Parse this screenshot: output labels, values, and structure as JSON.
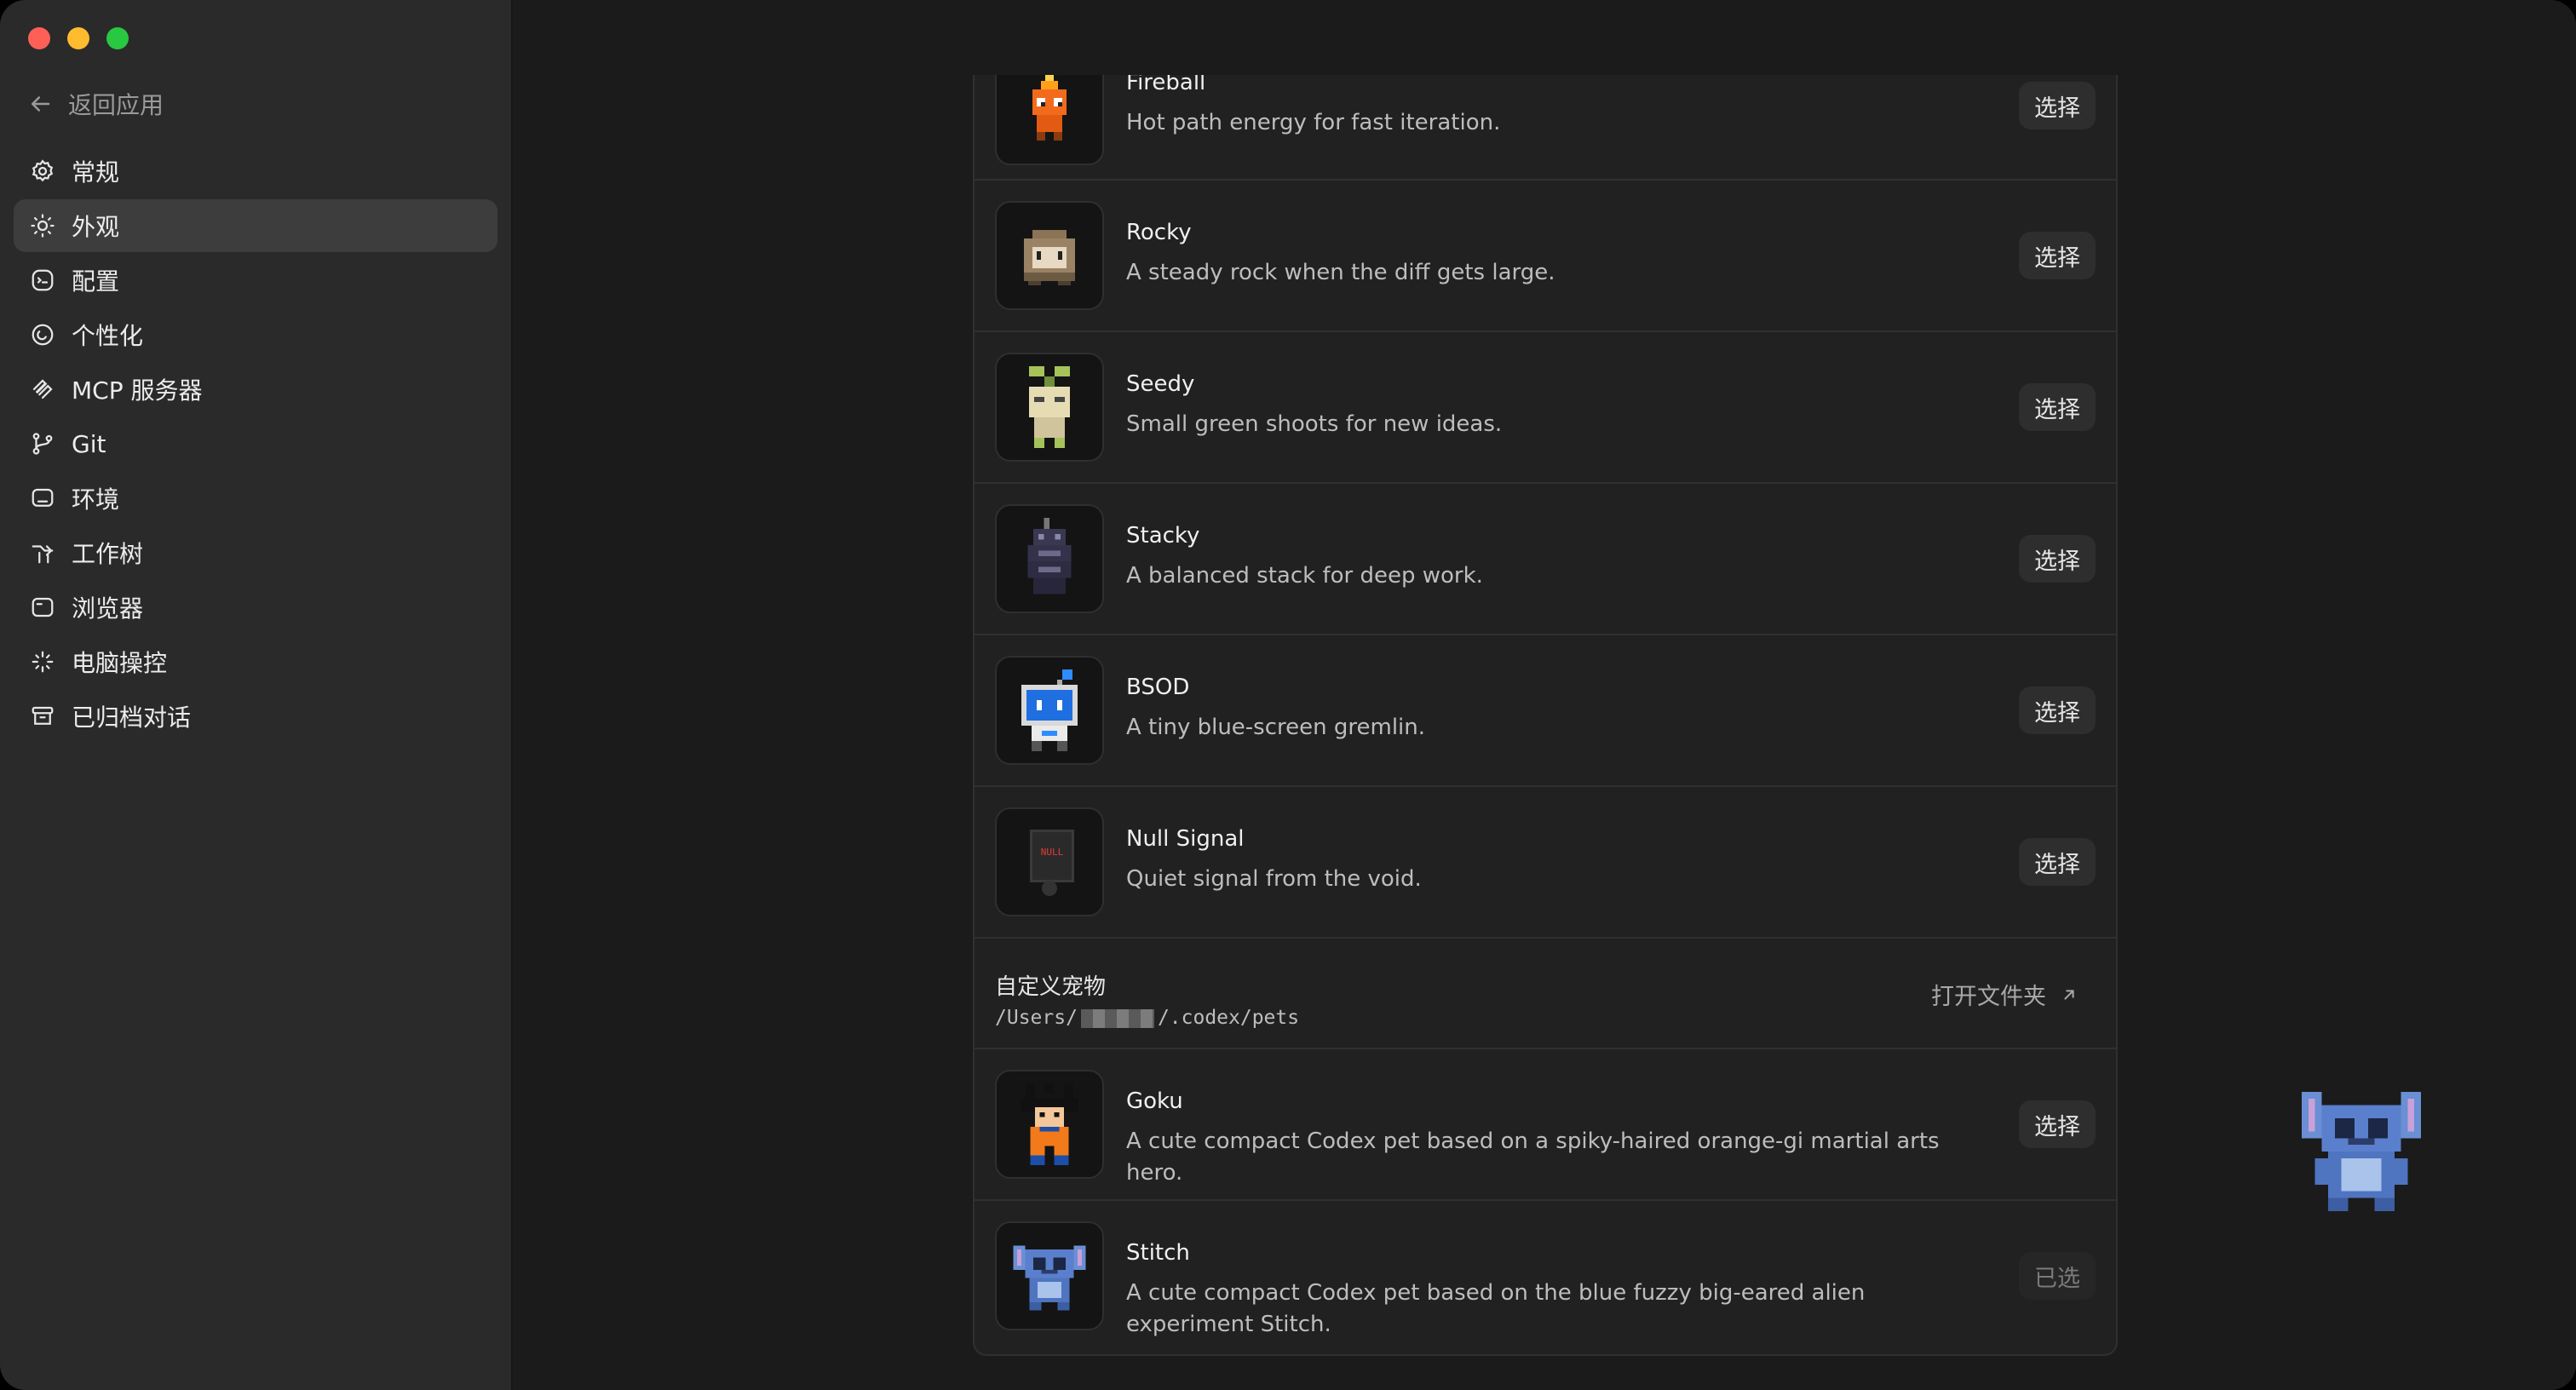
{
  "sidebar": {
    "back_label": "返回应用",
    "items": [
      {
        "label": "常规",
        "icon": "gear-icon"
      },
      {
        "label": "外观",
        "icon": "sun-icon",
        "active": true
      },
      {
        "label": "配置",
        "icon": "config-icon"
      },
      {
        "label": "个性化",
        "icon": "personalize-icon"
      },
      {
        "label": "MCP 服务器",
        "icon": "mcp-icon"
      },
      {
        "label": "Git",
        "icon": "git-branch-icon"
      },
      {
        "label": "环境",
        "icon": "monitor-icon"
      },
      {
        "label": "工作树",
        "icon": "worktree-icon"
      },
      {
        "label": "浏览器",
        "icon": "browser-icon"
      },
      {
        "label": "电脑操控",
        "icon": "sparkle-icon"
      },
      {
        "label": "已归档对话",
        "icon": "archive-icon"
      }
    ]
  },
  "pets": [
    {
      "name": "Fireball",
      "desc": "Hot path energy for fast iteration.",
      "action": "选择"
    },
    {
      "name": "Rocky",
      "desc": "A steady rock when the diff gets large.",
      "action": "选择"
    },
    {
      "name": "Seedy",
      "desc": "Small green shoots for new ideas.",
      "action": "选择"
    },
    {
      "name": "Stacky",
      "desc": "A balanced stack for deep work.",
      "action": "选择"
    },
    {
      "name": "BSOD",
      "desc": "A tiny blue-screen gremlin.",
      "action": "选择"
    },
    {
      "name": "Null Signal",
      "desc": "Quiet signal from the void.",
      "action": "选择",
      "badge": "NULL"
    }
  ],
  "custom": {
    "title": "自定义宠物",
    "path_prefix": "/Users/",
    "path_suffix": "/.codex/pets",
    "open_folder_label": "打开文件夹"
  },
  "custom_pets": [
    {
      "name": "Goku",
      "desc": "A cute compact Codex pet based on a spiky-haired orange-gi martial arts hero.",
      "action": "选择"
    },
    {
      "name": "Stitch",
      "desc": "A cute compact Codex pet based on the blue fuzzy big-eared alien experiment Stitch.",
      "action": "已选"
    }
  ],
  "colors": {
    "accent_active_bg": "#3d3d3d",
    "traffic_red": "#fe5f57",
    "traffic_yellow": "#febc2e",
    "traffic_green": "#28c840"
  }
}
